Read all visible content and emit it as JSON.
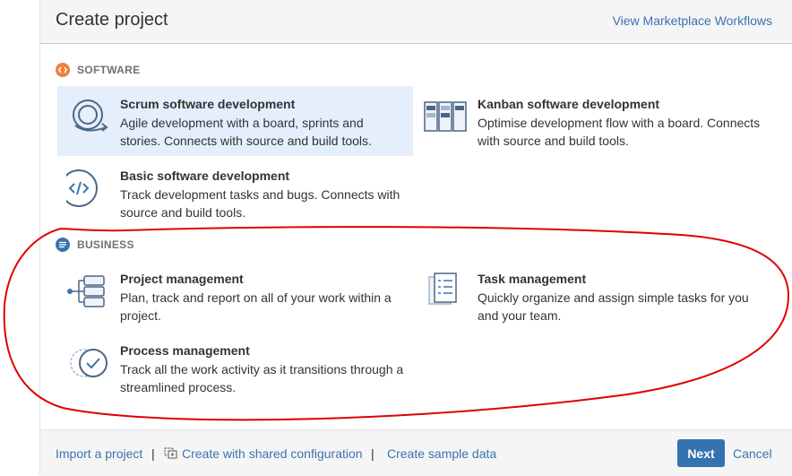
{
  "header": {
    "title": "Create project",
    "marketplace_link": "View Marketplace Workflows"
  },
  "sections": {
    "software": {
      "label": "SOFTWARE",
      "icon": "code-icon",
      "color": "#f0803c",
      "items": [
        {
          "title": "Scrum software development",
          "desc": "Agile development with a board, sprints and stories. Connects with source and build tools.",
          "icon": "scrum-cycle-icon",
          "selected": true
        },
        {
          "title": "Kanban software development",
          "desc": "Optimise development flow with a board. Connects with source and build tools.",
          "icon": "kanban-board-icon"
        },
        {
          "title": "Basic software development",
          "desc": "Track development tasks and bugs. Connects with source and build tools.",
          "icon": "code-brackets-icon"
        }
      ]
    },
    "business": {
      "label": "BUSINESS",
      "icon": "list-icon",
      "color": "#3b73af",
      "items": [
        {
          "title": "Project management",
          "desc": "Plan, track and report on all of your work within a project.",
          "icon": "project-hierarchy-icon"
        },
        {
          "title": "Task management",
          "desc": "Quickly organize and assign simple tasks for you and your team.",
          "icon": "task-checklist-icon"
        },
        {
          "title": "Process management",
          "desc": "Track all the work activity as it transitions through a streamlined process.",
          "icon": "process-check-icon"
        }
      ]
    }
  },
  "footer": {
    "import_link": "Import a project",
    "shared_config_link": "Create with shared configuration",
    "sample_data_link": "Create sample data",
    "separator": "|",
    "next_label": "Next",
    "cancel_label": "Cancel"
  },
  "colors": {
    "accent": "#3572b0",
    "link": "#3b73af",
    "selected_bg": "#e5eefb",
    "annotation": "#e00000"
  }
}
